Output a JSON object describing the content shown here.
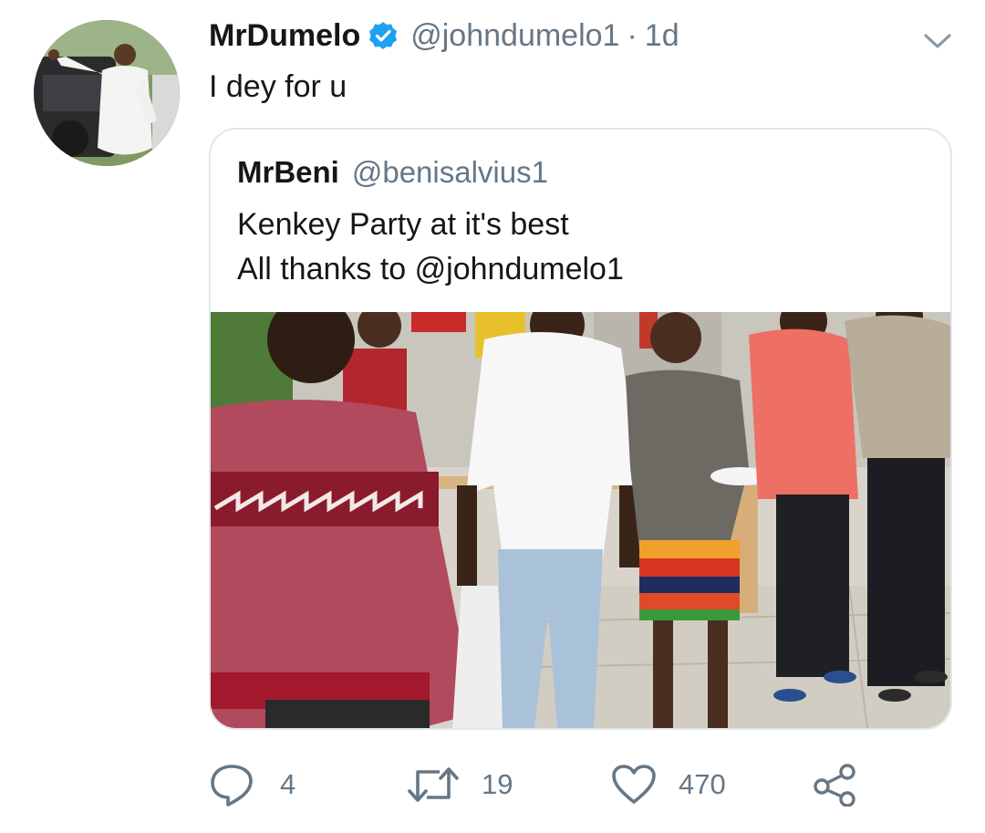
{
  "tweet": {
    "author_name": "MrDumelo",
    "author_handle": "@johndumelo1",
    "separator": "·",
    "timestamp": "1d",
    "text": "I dey for u",
    "verified": true
  },
  "quoted_tweet": {
    "author_name": "MrBeni",
    "author_handle": "@benisalvius1",
    "text_lines": [
      "Kenkey Party at it's best",
      "All thanks to @johndumelo1"
    ],
    "has_photo": true
  },
  "actions": {
    "reply": {
      "icon": "reply-icon",
      "count": "4"
    },
    "retweet": {
      "icon": "retweet-icon",
      "count": "19"
    },
    "like": {
      "icon": "heart-icon",
      "count": "470"
    },
    "share": {
      "icon": "share-icon"
    }
  },
  "colors": {
    "text": "#14171a",
    "secondary": "#657786",
    "verified": "#1da1f2",
    "border": "#e1e8ed"
  }
}
